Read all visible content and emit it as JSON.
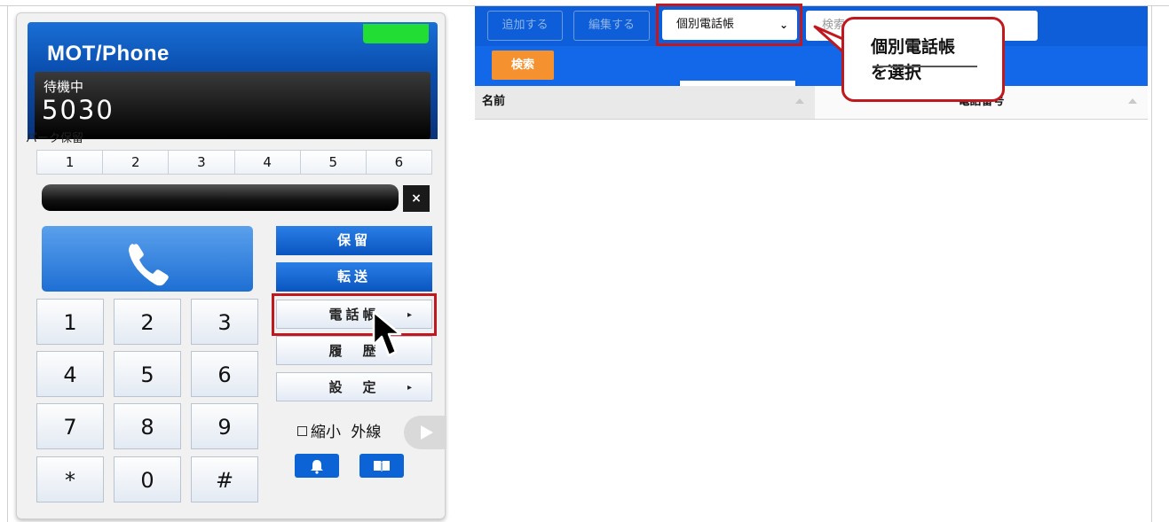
{
  "phone": {
    "brand": "MOT/Phone",
    "display": {
      "status": "待機中",
      "extension": "5030"
    },
    "park_label": "パーク保留",
    "park_slots": [
      "1",
      "2",
      "3",
      "4",
      "5",
      "6"
    ],
    "close_label": "×",
    "keys": [
      "1",
      "2",
      "3",
      "4",
      "5",
      "6",
      "7",
      "8",
      "9",
      "*",
      "0",
      "#"
    ],
    "side_buttons": {
      "hold": "保留",
      "transfer": "転送",
      "phonebook": "電話帳",
      "history": "履　歴",
      "settings": "設　定"
    },
    "arrow": "▸",
    "shrink_label": "縮小",
    "outside_line_label": "外線",
    "colors": {
      "accent_blue": "#0a55c0",
      "status_led": "#22dd33",
      "highlight": "#c0181e"
    }
  },
  "toolbar": {
    "add_label": "追加する",
    "edit_label": "編集する",
    "phonebook_select": "個別電話帳",
    "search_placeholder": "検索",
    "search_button": "検索"
  },
  "table": {
    "columns": [
      "名前",
      "電話番号"
    ]
  },
  "callout": {
    "line1": "個別電話帳",
    "line2": "を選択"
  }
}
